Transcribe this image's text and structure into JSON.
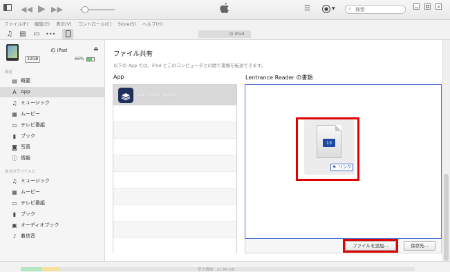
{
  "topbar": {
    "window_icon": "window-menu-icon",
    "rewind_icon": "rewind-icon",
    "play_icon": "play-icon",
    "forward_icon": "fast-forward-icon",
    "apple_icon": "apple-logo-icon",
    "list_icon": "list-icon",
    "account_icon": "account-icon",
    "search_placeholder": "検索",
    "volume_level": 0.15
  },
  "menubar": {
    "items": [
      "ファイル(F)",
      "編集(E)",
      "表示(V)",
      "コントロール(C)",
      "Store(S)",
      "ヘルプ(H)"
    ]
  },
  "toolbar": {
    "device_name": "　　　　　 の iPad",
    "icons": [
      "music-icon",
      "film-icon",
      "tv-icon",
      "more-icon",
      "ipad-icon"
    ]
  },
  "device": {
    "name": "　　　　　 の iPad",
    "capacity": "32GB",
    "battery": "66%"
  },
  "sidebar": {
    "settings_header": "設定",
    "settings_items": [
      {
        "label": "概要",
        "icon": "summary-icon"
      },
      {
        "label": "App",
        "icon": "app-icon"
      },
      {
        "label": "ミュージック",
        "icon": "music-icon"
      },
      {
        "label": "ムービー",
        "icon": "film-icon"
      },
      {
        "label": "テレビ番組",
        "icon": "tv-icon"
      },
      {
        "label": "ブック",
        "icon": "book-icon"
      },
      {
        "label": "写真",
        "icon": "camera-icon"
      },
      {
        "label": "情報",
        "icon": "info-icon"
      }
    ],
    "device_header": "自分のデバイス上",
    "device_items": [
      {
        "label": "ミュージック",
        "icon": "music-icon"
      },
      {
        "label": "ムービー",
        "icon": "film-icon"
      },
      {
        "label": "テレビ番組",
        "icon": "tv-icon"
      },
      {
        "label": "ブック",
        "icon": "book-icon"
      },
      {
        "label": "オーディオブック",
        "icon": "audiobook-icon"
      },
      {
        "label": "着信音",
        "icon": "bell-icon"
      }
    ]
  },
  "main": {
    "title": "ファイル共有",
    "subtitle": "以下の App では、iPad とこのコンピュータとの間で書類を転送できます。",
    "apps_header": "App",
    "app_list": [
      {
        "name": "Lentrance Reader",
        "icon": "lentrance-reader-icon"
      }
    ],
    "docs_header": "Lentrance Reader の書類",
    "document": {
      "icon": "document-icon",
      "number": "13",
      "link_label": "リンク"
    },
    "add_file_button": "ファイルを追加...",
    "save_button": "保存先..."
  },
  "bottombar": {
    "storage_text": "空き領域：22.84 GB"
  },
  "colors": {
    "highlight": "#e00000",
    "selected_row": "#d9d9d9",
    "docs_border": "#4a6fd1",
    "badge_blue": "#1b4aa3"
  }
}
